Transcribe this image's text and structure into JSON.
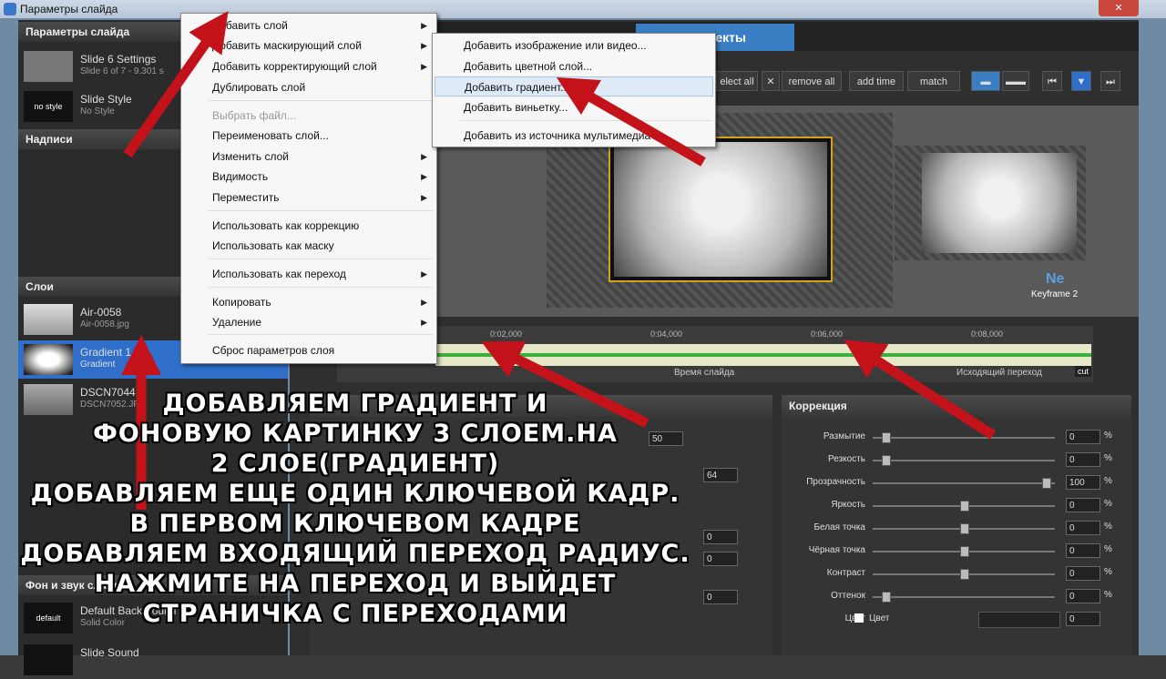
{
  "window": {
    "title": "Параметры слайда",
    "close": "✕"
  },
  "left_panel": {
    "header": "Параметры слайда",
    "slide_settings": {
      "title": "Slide 6 Settings",
      "sub": "Slide 6 of 7 - 9.301 s"
    },
    "style": {
      "thumb": "no style",
      "title": "Slide Style",
      "sub": "No Style"
    },
    "captions_header": "Надписи",
    "layers_header": "Слои",
    "layers": [
      {
        "title": "Air-0058",
        "sub": "Air-0058.jpg"
      },
      {
        "title": "Gradient 1",
        "sub": "Gradient"
      },
      {
        "title": "DSCN7044",
        "sub": "DSCN7052.JPG"
      }
    ],
    "bg_header": "Фон и звук слайда",
    "bg": {
      "thumb": "default",
      "title": "Default Background",
      "sub": "Solid Color"
    },
    "sound": {
      "title": "Slide Sound"
    }
  },
  "tabs": {
    "effects": "Эффекты"
  },
  "toolbar": {
    "select_all": "elect all",
    "remove_all": "remove all",
    "add_time": "add time",
    "match": "match"
  },
  "preview": {
    "next_label": "Ne",
    "keyframe": "Keyframe 2"
  },
  "timeline": {
    "ticks": [
      "0:02,000",
      "0:04,000",
      "0:06,000",
      "0:08,000"
    ],
    "slide_time": "Время слайда",
    "out_transition": "Исходящий переход",
    "cut": "cut"
  },
  "left_bottom": {
    "v1": "50",
    "v2": "64",
    "v3": "0",
    "v4": "0",
    "v5": "0"
  },
  "correction": {
    "header": "Коррекция",
    "rows": [
      {
        "label": "Размытие",
        "value": "0",
        "unit": "%"
      },
      {
        "label": "Резкость",
        "value": "0",
        "unit": "%"
      },
      {
        "label": "Прозрачность",
        "value": "100",
        "unit": "%"
      },
      {
        "label": "Яркость",
        "value": "0",
        "unit": "%"
      },
      {
        "label": "Белая точка",
        "value": "0",
        "unit": "%"
      },
      {
        "label": "Чёрная точка",
        "value": "0",
        "unit": "%"
      },
      {
        "label": "Контраст",
        "value": "0",
        "unit": "%"
      },
      {
        "label": "Оттенок",
        "value": "0",
        "unit": "%"
      }
    ],
    "color_label": "Цвет",
    "color_check": "Цвет",
    "color_value": "0"
  },
  "context_menu": {
    "items": [
      {
        "label": "Добавить слой",
        "sub": true
      },
      {
        "label": "Добавить маскирующий слой",
        "sub": true
      },
      {
        "label": "Добавить корректирующий слой",
        "sub": true
      },
      {
        "label": "Дублировать слой"
      },
      {
        "label": "Выбрать файл...",
        "disabled": true
      },
      {
        "label": "Переименовать слой..."
      },
      {
        "label": "Изменить слой",
        "sub": true
      },
      {
        "label": "Видимость",
        "sub": true
      },
      {
        "label": "Переместить",
        "sub": true
      },
      {
        "label": "Использовать как коррекцию"
      },
      {
        "label": "Использовать как маску"
      },
      {
        "label": "Использовать как переход",
        "sub": true
      },
      {
        "label": "Копировать",
        "sub": true
      },
      {
        "label": "Удаление",
        "sub": true
      },
      {
        "label": "Сброс параметров слоя"
      }
    ]
  },
  "submenu": {
    "items": [
      "Добавить изображение или видео...",
      "Добавить цветной слой...",
      "Добавить градиент...",
      "Добавить виньетку...",
      "Добавить из источника мультимедиа"
    ]
  },
  "caption_lines": [
    "ДОБАВЛЯЕМ ГРАДИЕНТ И",
    "ФОНОВУЮ КАРТИНКУ 3 СЛОЕМ.НА",
    "2 СЛОЕ(ГРАДИЕНТ)",
    "ДОБАВЛЯЕМ ЕЩЕ ОДИН КЛЮЧЕВОЙ КАДР.",
    "В ПЕРВОМ КЛЮЧЕВОМ КАДРЕ",
    "ДОБАВЛЯЕМ ВХОДЯЩИЙ ПЕРЕХОД РАДИУС.",
    "НАЖМИТЕ НА ПЕРЕХОД И ВЫЙДЕТ",
    "СТРАНИЧКА С ПЕРЕХОДАМИ"
  ],
  "colors": {
    "accent": "#2f6fc9",
    "arrow": "#c4121b",
    "wave": "#3bb03b"
  }
}
